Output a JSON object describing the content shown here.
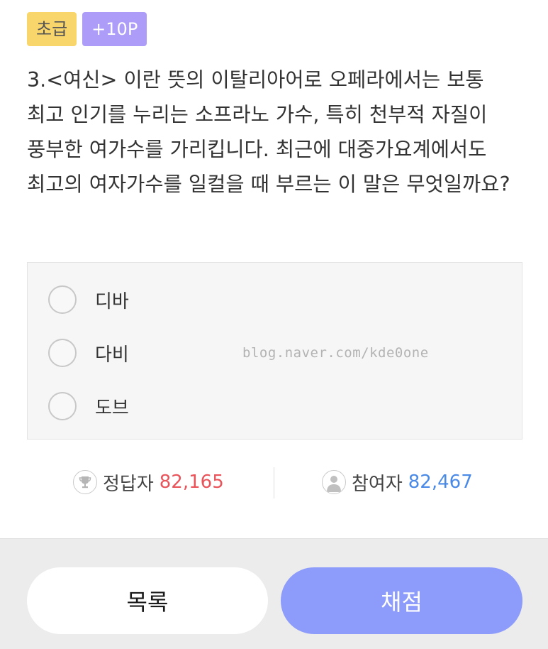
{
  "badges": {
    "level": "초급",
    "points": "+10P"
  },
  "question": {
    "text": "3.<여신> 이란 뜻의 이탈리아어로 오페라에서는 보통 최고 인기를 누리는 소프라노 가수, 특히 천부적 자질이 풍부한 여가수를 가리킵니다. 최근에 대중가요계에서도 최고의 여자가수를 일컬을 때 부르는 이 말은 무엇일까요?"
  },
  "options": [
    {
      "label": "디바",
      "selected": false
    },
    {
      "label": "다비",
      "selected": false
    },
    {
      "label": "도브",
      "selected": false
    }
  ],
  "watermark": "blog.naver.com/kde0one",
  "stats": {
    "correct_label": "정답자",
    "correct_value": "82,165",
    "participants_label": "참여자",
    "participants_value": "82,467",
    "icons": {
      "correct": "trophy-icon",
      "participants": "user-icon"
    }
  },
  "buttons": {
    "list_label": "목록",
    "grade_label": "채점"
  },
  "colors": {
    "level_badge": "#f9d66b",
    "points_badge": "#ad9cf8",
    "correct_value": "#e9545b",
    "participants_value": "#4a8ae6",
    "grade_button": "#8d9bfa"
  }
}
